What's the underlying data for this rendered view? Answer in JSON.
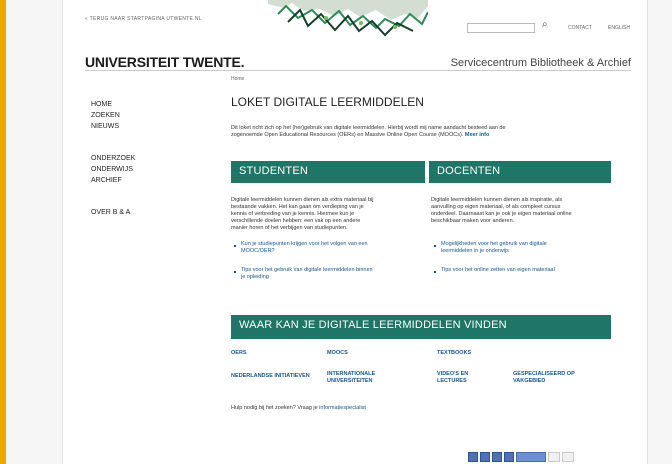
{
  "header": {
    "back_link": "« TERUG NAAR STARTPAGINA UTWENTE.NL",
    "logo": "UNIVERSITEIT TWENTE.",
    "service_title": "Servicecentrum Bibliotheek & Archief",
    "search": {
      "value": "",
      "placeholder": ""
    },
    "links": {
      "contact": "CONTACT",
      "english": "ENGLISH"
    }
  },
  "breadcrumb": "Home",
  "sidebar": {
    "group1": [
      "HOME",
      "ZOEKEN",
      "NIEUWS"
    ],
    "group2": [
      "ONDERZOEK",
      "ONDERWIJS",
      "ARCHIEF"
    ],
    "group3": [
      "OVER B & A"
    ]
  },
  "main": {
    "title": "LOKET DIGITALE LEERMIDDELEN",
    "intro_line1": "Dit loket richt zich op het (her)gebruik van digitale leermiddelen. Hierbij wordt mij name aandacht besteed aan de",
    "intro_line2": "zogenoemde Open Educational Resources (OERs) en Massive Online Open Course (MOOCs).",
    "intro_more": "Meer info",
    "students": {
      "heading": "STUDENTEN",
      "line1": "Digitale leermiddelen kunnen dienen als extra materiaal bij",
      "line2": "bestaande vakken. Het kan gaan om verdieping van je",
      "line3": "kennis of verbreding van je kennis. Hiermee kun je",
      "line4": "verschillende doelen hebben: een vak op een andere",
      "line5": "manier horen of het verbijgen van studiepunten.",
      "link1_a": "Kun je studiepunten krijgen voor het volgen van een",
      "link1_b": "MOOC/OER?",
      "link2_a": "Tips voor het gebruik van digitale leermiddelen binnen",
      "link2_b": "je opleiding"
    },
    "teachers": {
      "heading": "DOCENTEN",
      "line1": "Digitale leermiddelen kunnen dienen als inspiratie, als",
      "line2": "aanvulling op eigen materiaal, of als compleet cursus",
      "line3": "onderdeel. Daarnaast kan je ook je eigen materiaal online",
      "line4": "beschikbaar maken voor anderen.",
      "link1_a": "Mogelijkheden voor het gebruik van digitale",
      "link1_b": "leermiddelen in je onderwijs",
      "link2": "Tips voor het online zetten van eigen materiaal"
    },
    "where_heading": "WAAR KAN JE DIGITALE LEERMIDDELEN VINDEN",
    "resources": {
      "oers": "OERS",
      "moocs": "MOOCS",
      "textbooks": "TEXTBOOKS",
      "nl_initiatives": "NEDERLANDSE INITIATIEVEN",
      "intl_a": "INTERNATIONALE",
      "intl_b": "UNIVERSITEITEN",
      "video_a": "VIDEO'S EN",
      "video_b": "LECTURES",
      "special_a": "GESPECIALISEERD OP",
      "special_b": "VAKGEBIED"
    },
    "help_text": "Hulp nodig bij het zoeken? Vraag je",
    "help_link": "informatiespecialist"
  },
  "colors": {
    "accent_orange": "#f2a700",
    "teal": "#1f7566",
    "link_blue": "#15568f"
  },
  "icons": [
    "search-icon",
    "share-icons"
  ]
}
